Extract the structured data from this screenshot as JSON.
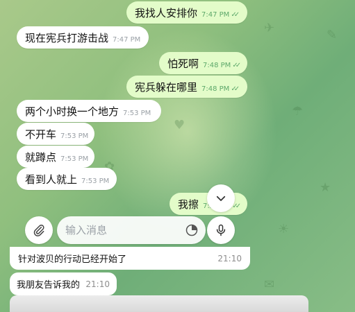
{
  "messages": [
    {
      "dir": "out",
      "text": "我找人安排你",
      "time": "7:47 PM",
      "ticks": "✓✓"
    },
    {
      "dir": "in",
      "text": "现在宪兵打游击战",
      "time": "7:47 PM"
    },
    {
      "dir": "out",
      "text": "怕死啊",
      "time": "7:48 PM",
      "ticks": "✓✓"
    },
    {
      "dir": "out",
      "text": "宪兵躲在哪里",
      "time": "7:48 PM",
      "ticks": "✓✓"
    },
    {
      "dir": "in",
      "text": "两个小时换一个地方",
      "time": "7:53 PM"
    },
    {
      "dir": "in",
      "text": "不开车",
      "time": "7:53 PM"
    },
    {
      "dir": "in",
      "text": "就蹲点",
      "time": "7:53 PM"
    },
    {
      "dir": "in",
      "text": "看到人就上",
      "time": "7:53 PM"
    },
    {
      "dir": "out",
      "text": "我擦",
      "time": "7:53 PM",
      "ticks": "✓✓"
    }
  ],
  "composer": {
    "placeholder": "输入消息",
    "attach_icon": "paperclip-icon",
    "sticker_icon": "sticker-icon",
    "mic_icon": "microphone-icon",
    "scroll_icon": "chevron-down-icon"
  },
  "overlay": {
    "row1": {
      "text": "针对波贝的行动已经开始了",
      "time": "21:10"
    },
    "row2": {
      "text": "我朋友告诉我的",
      "time": "21:10"
    }
  },
  "colors": {
    "incoming_bubble": "#ffffff",
    "outgoing_bubble": "#e3fcc9",
    "outgoing_time": "#5da86a",
    "background_green": "#8fbf7e"
  }
}
